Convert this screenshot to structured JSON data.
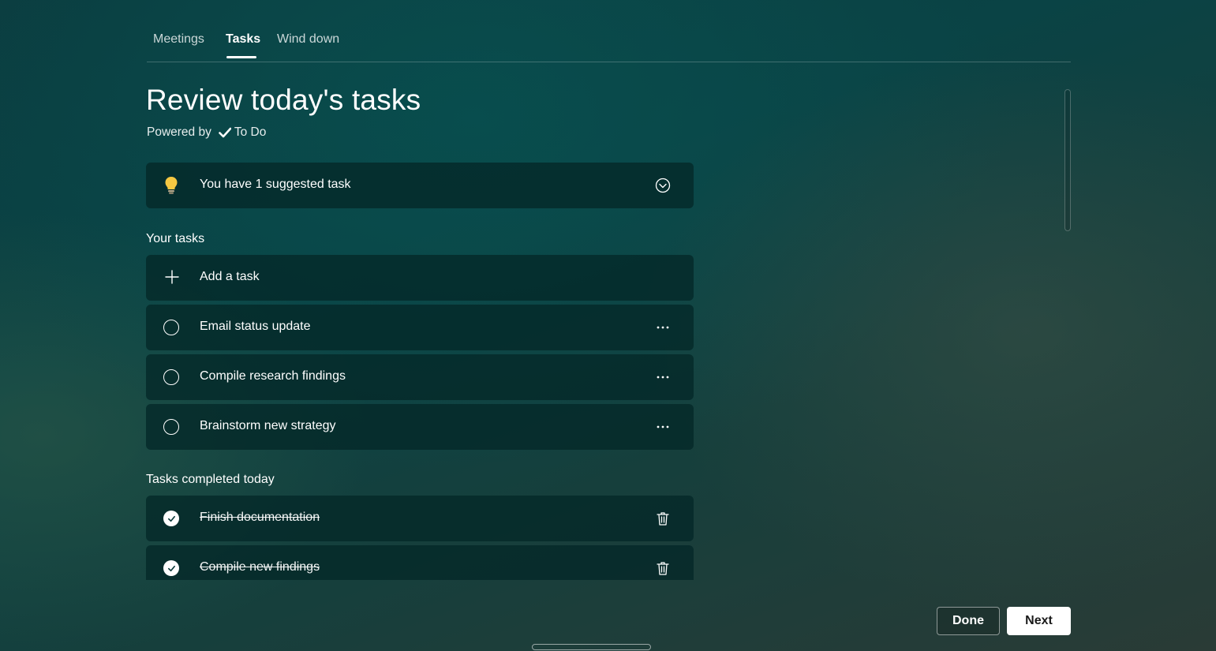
{
  "tabs": [
    {
      "label": "Meetings",
      "active": false
    },
    {
      "label": "Tasks",
      "active": true
    },
    {
      "label": "Wind down",
      "active": false
    }
  ],
  "page": {
    "title": "Review today's tasks",
    "powered_by": "Powered by",
    "app_name": "To Do"
  },
  "suggestion": {
    "icon": "lightbulb-icon",
    "text": "You have 1 suggested task",
    "expand_icon": "chevron-down-circle-icon"
  },
  "your_tasks": {
    "heading": "Your tasks",
    "add_label": "Add a task",
    "items": [
      {
        "label": "Email status update",
        "completed": false
      },
      {
        "label": "Compile research findings",
        "completed": false
      },
      {
        "label": "Brainstorm new strategy",
        "completed": false
      }
    ]
  },
  "completed": {
    "heading": "Tasks completed today",
    "items": [
      {
        "label": "Finish documentation",
        "completed": true
      },
      {
        "label": "Compile new findings",
        "completed": true
      }
    ]
  },
  "footer": {
    "done_label": "Done",
    "next_label": "Next"
  },
  "colors": {
    "accent": "#ffffff",
    "card_bg": "#0a3a3a",
    "bulb": "#f5c842"
  }
}
